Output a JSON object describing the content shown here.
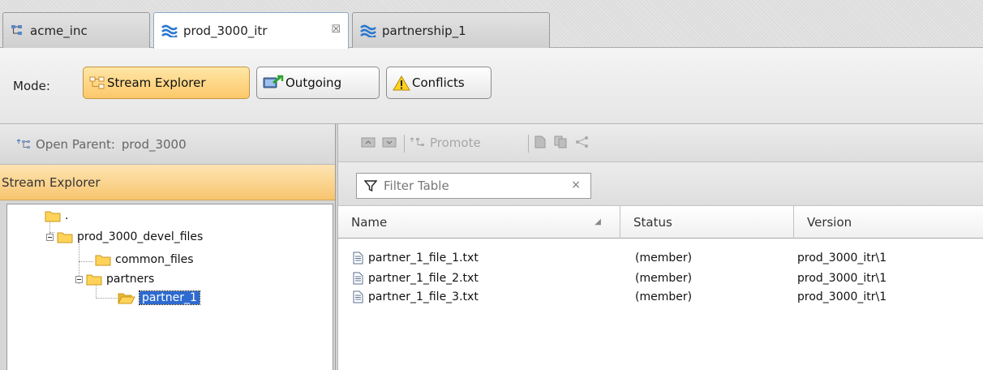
{
  "tabs": [
    {
      "label": "acme_inc",
      "icon": "stream-tree-icon"
    },
    {
      "label": "prod_3000_itr",
      "icon": "workspace-waves-icon",
      "active": true,
      "close": "☒"
    },
    {
      "label": "partnership_1",
      "icon": "workspace-waves-icon"
    }
  ],
  "mode": {
    "label": "Mode:",
    "buttons": [
      {
        "label": "Stream Explorer",
        "icon": "stream-explorer-icon",
        "selected": true
      },
      {
        "label": "Outgoing",
        "icon": "outgoing-icon"
      },
      {
        "label": "Conflicts",
        "icon": "warning-icon"
      }
    ]
  },
  "open_parent": {
    "label": "Open Parent:",
    "value": "prod_3000"
  },
  "explorer": {
    "title": "Stream Explorer",
    "tree": [
      {
        "label": ".",
        "depth": 0
      },
      {
        "label": "prod_3000_devel_files",
        "depth": 1,
        "expanded": true
      },
      {
        "label": "common_files",
        "depth": 2
      },
      {
        "label": "partners",
        "depth": 2,
        "expanded": true
      },
      {
        "label": "partner_1",
        "depth": 3,
        "selected": true
      }
    ]
  },
  "toolbar": {
    "promote_label": "Promote"
  },
  "filter": {
    "placeholder": "Filter Table",
    "clear": "×"
  },
  "table": {
    "columns": [
      "Name",
      "Status",
      "Version"
    ],
    "rows": [
      {
        "name": "partner_1_file_1.txt",
        "status": "(member)",
        "version": "prod_3000_itr\\1"
      },
      {
        "name": "partner_1_file_2.txt",
        "status": "(member)",
        "version": "prod_3000_itr\\1"
      },
      {
        "name": "partner_1_file_3.txt",
        "status": "(member)",
        "version": "prod_3000_itr\\1"
      }
    ]
  },
  "colors": {
    "accent_orange": "#f8c56e",
    "selection_blue": "#2e6bd1",
    "tab_active_border": "#8fa8c8"
  }
}
